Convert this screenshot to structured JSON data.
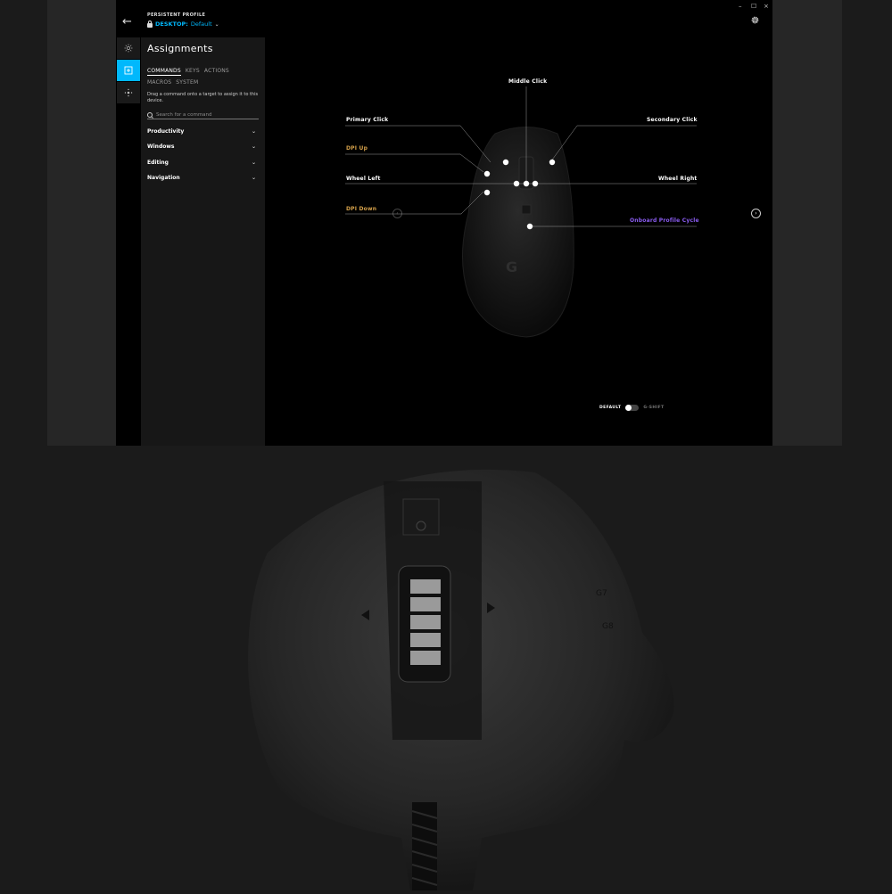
{
  "app": {
    "profile_label": "PERSISTENT PROFILE",
    "profile_prefix": "DESKTOP:",
    "profile_value": "Default",
    "back_icon": "arrow-left-icon",
    "window_controls": {
      "minimize": "–",
      "maximize": "☐",
      "close": "×"
    }
  },
  "rail": {
    "items": [
      {
        "icon": "lighting-icon",
        "active": false
      },
      {
        "icon": "assignments-icon",
        "active": true
      },
      {
        "icon": "dpi-sensitivity-icon",
        "active": false
      }
    ]
  },
  "panel": {
    "title": "Assignments",
    "tabs": [
      "COMMANDS",
      "KEYS",
      "ACTIONS",
      "MACROS",
      "SYSTEM"
    ],
    "active_tab": "COMMANDS",
    "hint": "Drag a command onto a target to assign it to this device.",
    "search_placeholder": "Search for a command",
    "categories": [
      "Productivity",
      "Windows",
      "Editing",
      "Navigation"
    ]
  },
  "device": {
    "callouts": [
      {
        "label": "Middle Click",
        "color": "#ffffff"
      },
      {
        "label": "Primary Click",
        "color": "#ffffff"
      },
      {
        "label": "Secondary Click",
        "color": "#ffffff"
      },
      {
        "label": "DPI Up",
        "color": "#d4a04a"
      },
      {
        "label": "Wheel Left",
        "color": "#ffffff"
      },
      {
        "label": "Wheel Right",
        "color": "#ffffff"
      },
      {
        "label": "DPI Down",
        "color": "#d4a04a"
      },
      {
        "label": "Onboard Profile Cycle",
        "color": "#8a5cf0"
      }
    ],
    "mode_default": "DEFAULT",
    "mode_gshift": "G-SHIFT",
    "gshift_enabled": false
  },
  "colors": {
    "accent": "#00b8fc",
    "dpi": "#d4a04a",
    "profile_cycle": "#8a5cf0"
  }
}
